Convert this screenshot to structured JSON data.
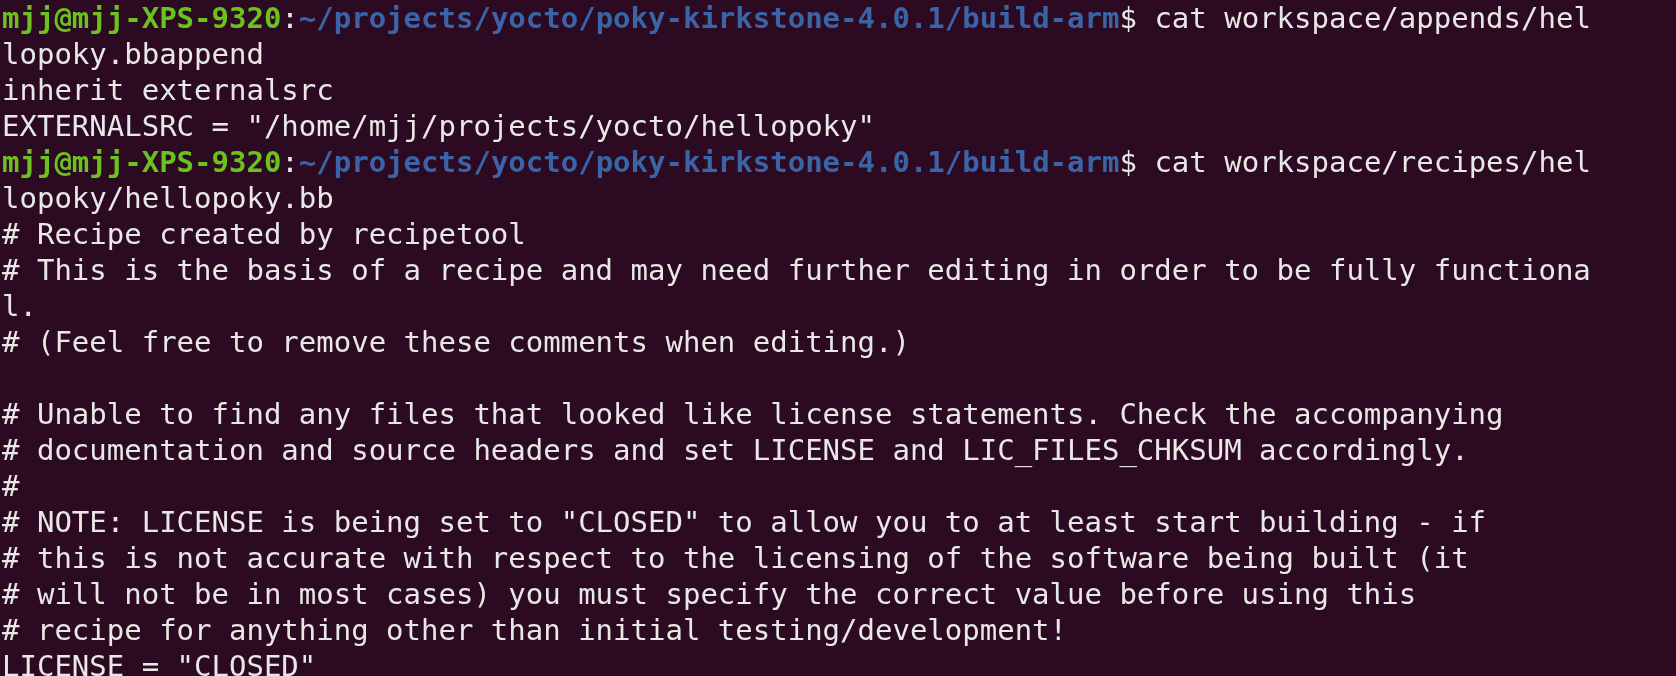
{
  "terminal": {
    "lines": [
      {
        "kind": "prompt",
        "user_host": "mjj@mjj-XPS-9320",
        "separator": ":",
        "path": "~/projects/yocto/poky-kirkstone-4.0.1/build-arm",
        "symbol": "$",
        "command": "cat workspace/appends/hel"
      },
      {
        "kind": "output",
        "text": "lopoky.bbappend"
      },
      {
        "kind": "output",
        "text": "inherit externalsrc"
      },
      {
        "kind": "output",
        "text": "EXTERNALSRC = \"/home/mjj/projects/yocto/hellopoky\""
      },
      {
        "kind": "prompt",
        "user_host": "mjj@mjj-XPS-9320",
        "separator": ":",
        "path": "~/projects/yocto/poky-kirkstone-4.0.1/build-arm",
        "symbol": "$",
        "command": "cat workspace/recipes/hel"
      },
      {
        "kind": "output",
        "text": "lopoky/hellopoky.bb"
      },
      {
        "kind": "output",
        "text": "# Recipe created by recipetool"
      },
      {
        "kind": "output",
        "text": "# This is the basis of a recipe and may need further editing in order to be fully functiona"
      },
      {
        "kind": "output",
        "text": "l."
      },
      {
        "kind": "output",
        "text": "# (Feel free to remove these comments when editing.)"
      },
      {
        "kind": "blank"
      },
      {
        "kind": "output",
        "text": "# Unable to find any files that looked like license statements. Check the accompanying"
      },
      {
        "kind": "output",
        "text": "# documentation and source headers and set LICENSE and LIC_FILES_CHKSUM accordingly."
      },
      {
        "kind": "output",
        "text": "#"
      },
      {
        "kind": "output",
        "text": "# NOTE: LICENSE is being set to \"CLOSED\" to allow you to at least start building - if"
      },
      {
        "kind": "output",
        "text": "# this is not accurate with respect to the licensing of the software being built (it"
      },
      {
        "kind": "output",
        "text": "# will not be in most cases) you must specify the correct value before using this"
      },
      {
        "kind": "output",
        "text": "# recipe for anything other than initial testing/development!"
      },
      {
        "kind": "output",
        "text": "LICENSE = \"CLOSED\""
      }
    ]
  }
}
